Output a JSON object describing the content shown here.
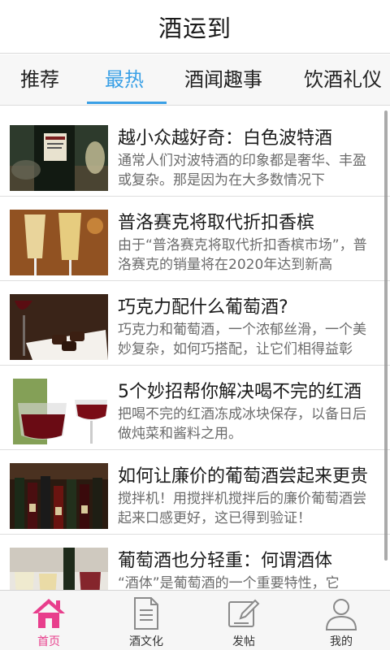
{
  "app": {
    "title": "酒运到"
  },
  "tabs": [
    {
      "label": "推荐",
      "active": false
    },
    {
      "label": "最热",
      "active": true
    },
    {
      "label": "酒闻趣事",
      "active": false
    },
    {
      "label": "饮酒礼仪",
      "active": false
    }
  ],
  "colors": {
    "accent_tab": "#3aa0e6",
    "accent_nav": "#e83e8c"
  },
  "articles": [
    {
      "title": "越小众越好奇：白色波特酒",
      "desc": "通常人们对波特酒的印象都是奢华、丰盈或复杂。那是因为在大多数情况下",
      "thumb": "port-bottle-image"
    },
    {
      "title": "普洛赛克将取代折扣香槟",
      "desc": "由于“普洛赛克将取代折扣香槟市场”，普洛赛克的销量将在2020年达到新高",
      "thumb": "champagne-flutes-image"
    },
    {
      "title": "巧克力配什么葡萄酒?",
      "desc": "巧克力和葡萄酒，一个浓郁丝滑，一个美妙复杂，如何巧搭配，让它们相得益彰",
      "thumb": "chocolate-wine-image"
    },
    {
      "title": "5个妙招帮你解决喝不完的红酒",
      "desc": "把喝不完的红酒冻成冰块保存，以备日后做炖菜和酱料之用。",
      "thumb": "red-wine-glass-image"
    },
    {
      "title": "如何让廉价的葡萄酒尝起来更贵",
      "desc": "搅拌机！用搅拌机搅拌后的廉价葡萄酒尝起来口感更好，这已得到验证！",
      "thumb": "wine-shelf-image"
    },
    {
      "title": "葡萄酒也分轻重：何谓酒体",
      "desc": "“酒体”是葡萄酒的一个重要特性，它",
      "thumb": "wine-glasses-row-image"
    }
  ],
  "bottom_nav": [
    {
      "label": "首页",
      "icon": "home-icon",
      "active": true
    },
    {
      "label": "酒文化",
      "icon": "document-icon",
      "active": false
    },
    {
      "label": "发帖",
      "icon": "edit-icon",
      "active": false
    },
    {
      "label": "我的",
      "icon": "user-icon",
      "active": false
    }
  ]
}
